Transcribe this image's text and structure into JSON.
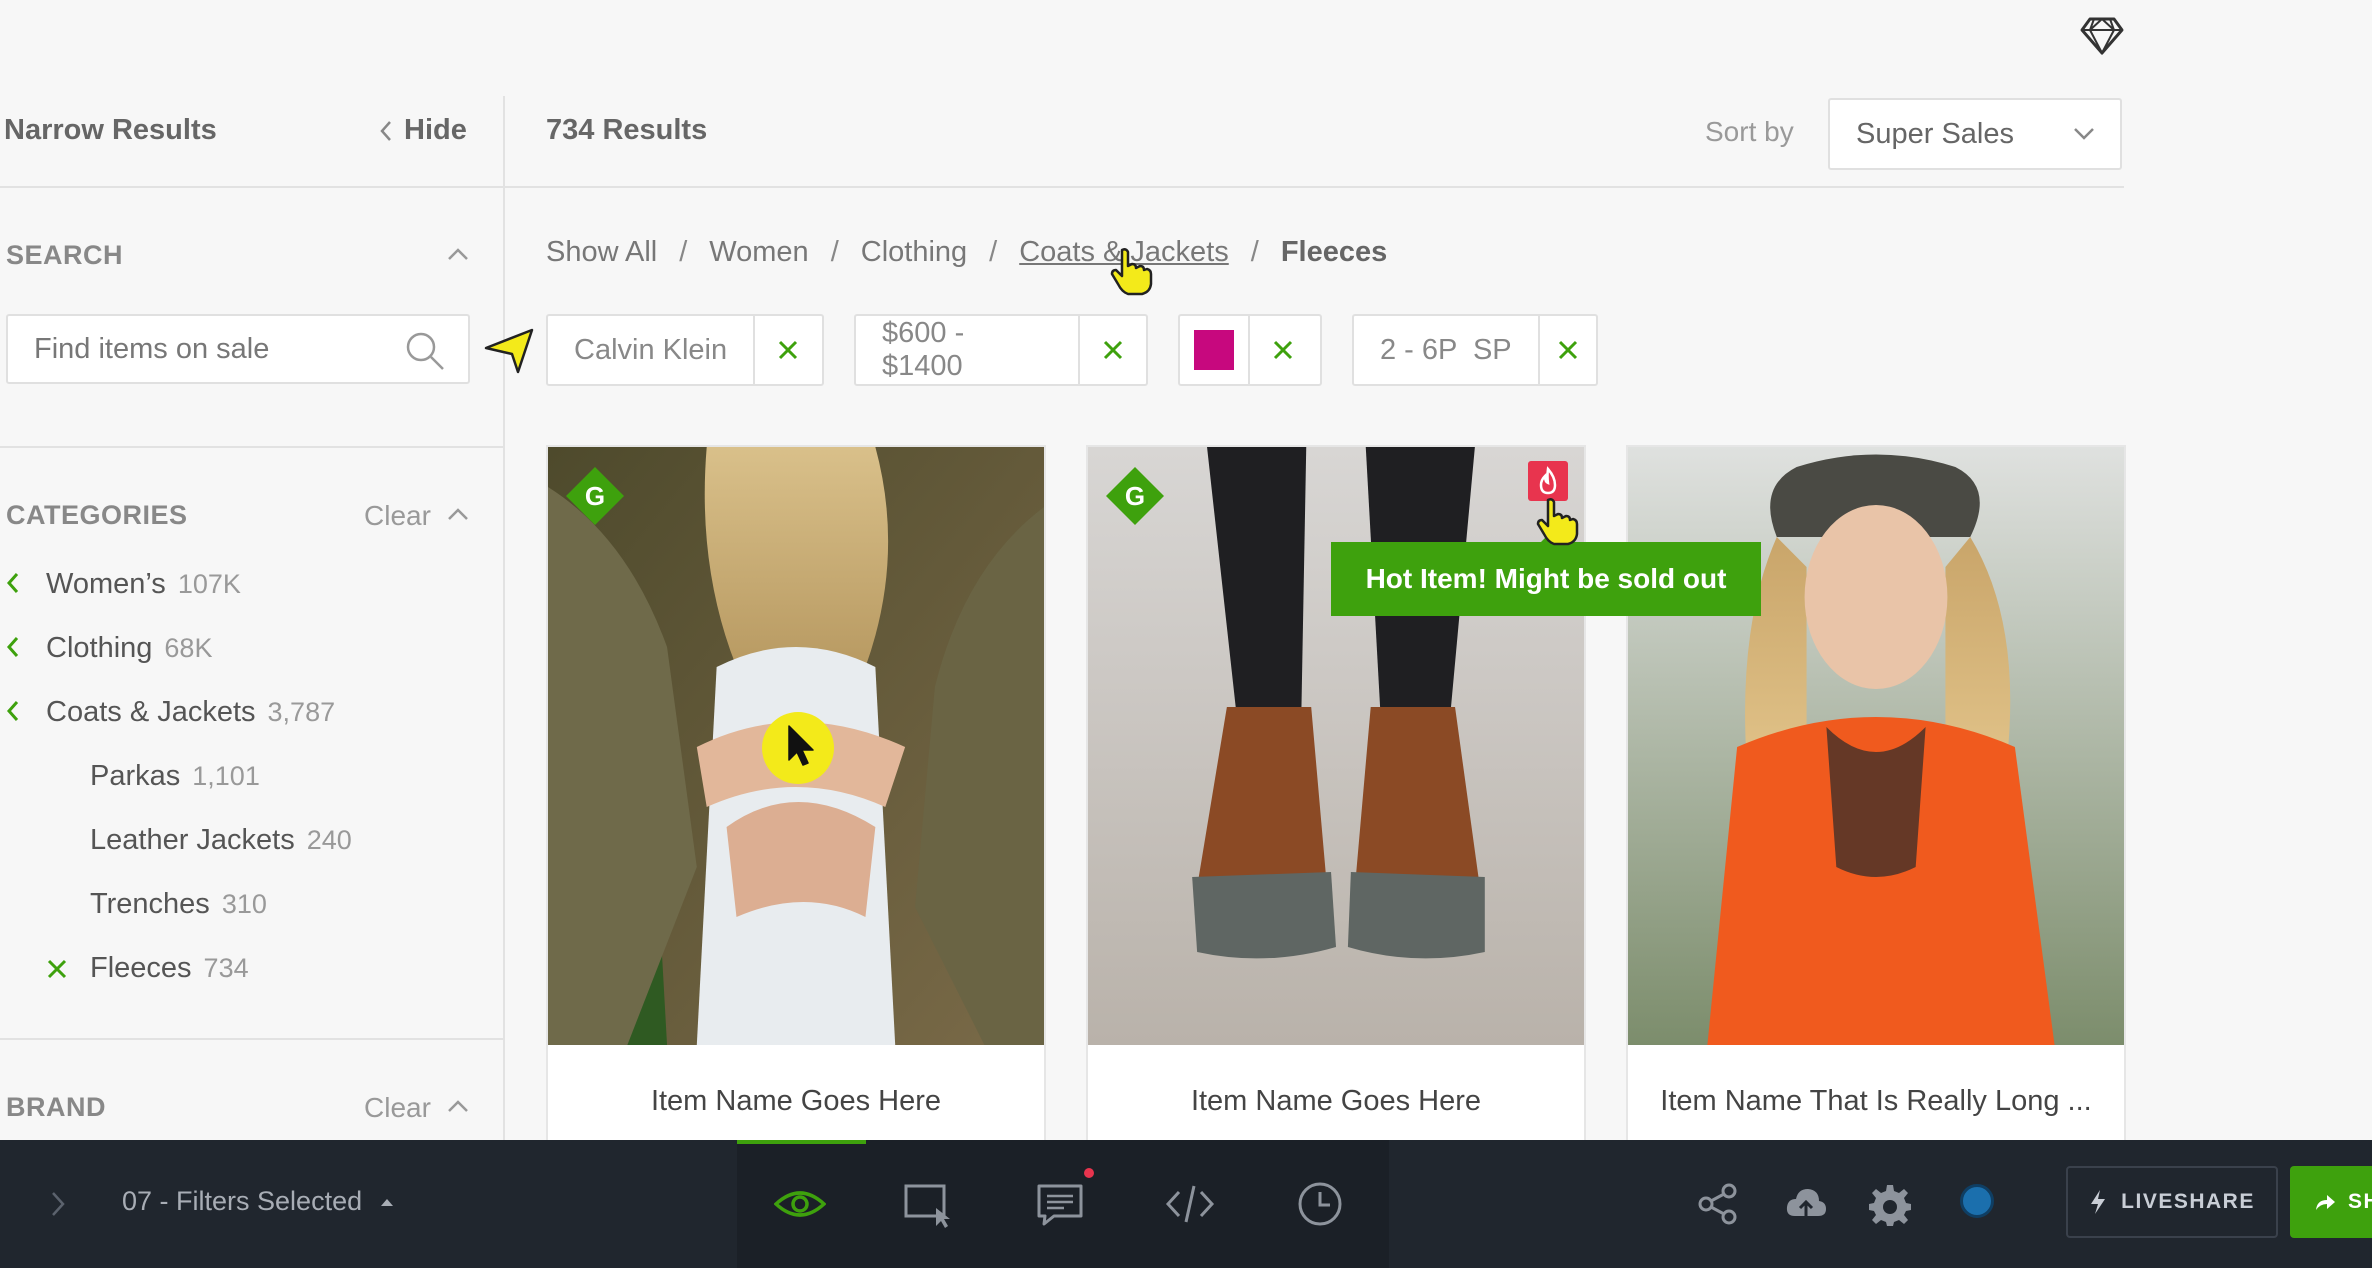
{
  "colors": {
    "accent_green": "#3ea10d",
    "swatch_magenta": "#c7087e",
    "toolbar_bg": "#20262e",
    "hot_red": "#e8344e"
  },
  "sidebar": {
    "title": "Narrow Results",
    "hide_label": "Hide",
    "search_section": {
      "title": "SEARCH",
      "placeholder": "Find items on sale"
    },
    "categories_section": {
      "title": "CATEGORIES",
      "clear_label": "Clear",
      "items": [
        {
          "label": "Women’s",
          "count": "107K",
          "icon": "chevron-left-icon"
        },
        {
          "label": "Clothing",
          "count": "68K",
          "icon": "chevron-left-icon"
        },
        {
          "label": "Coats & Jackets",
          "count": "3,787",
          "icon": "chevron-left-icon"
        },
        {
          "label": "Parkas",
          "count": "1,101"
        },
        {
          "label": "Leather Jackets",
          "count": "240"
        },
        {
          "label": "Trenches",
          "count": "310"
        },
        {
          "label": "Fleeces",
          "count": "734",
          "icon": "close-icon"
        }
      ]
    },
    "brand_section": {
      "title": "BRAND",
      "clear_label": "Clear"
    }
  },
  "results": {
    "count_label": "734 Results",
    "sort_label": "Sort by",
    "sort_value": "Super Sales"
  },
  "breadcrumb": {
    "items": [
      "Show All",
      "Women",
      "Clothing",
      "Coats & Jackets",
      "Fleeces"
    ],
    "separator": "/"
  },
  "filters": [
    {
      "label": "Calvin Klein"
    },
    {
      "label": "$600 - $1400"
    },
    {
      "label": "",
      "swatch": "#c7087e"
    },
    {
      "label": "2 - 6P  SP"
    }
  ],
  "products": [
    {
      "name": "Item Name Goes Here",
      "badge": "G"
    },
    {
      "name": "Item Name Goes Here",
      "badge": "G",
      "hot": true
    },
    {
      "name": "Item Name That Is Really Long ..."
    }
  ],
  "tooltip": "Hot Item! Might be sold out",
  "toolbar": {
    "filters_label": "07 - Filters Selected",
    "tools": [
      "eye-icon",
      "screen-select-icon",
      "comment-icon",
      "code-icon",
      "history-icon"
    ],
    "right_icons": [
      "share-icon",
      "cloud-upload-icon",
      "gear-icon"
    ],
    "liveshare_label": "LIVESHARE",
    "share_label": "SHARE"
  }
}
